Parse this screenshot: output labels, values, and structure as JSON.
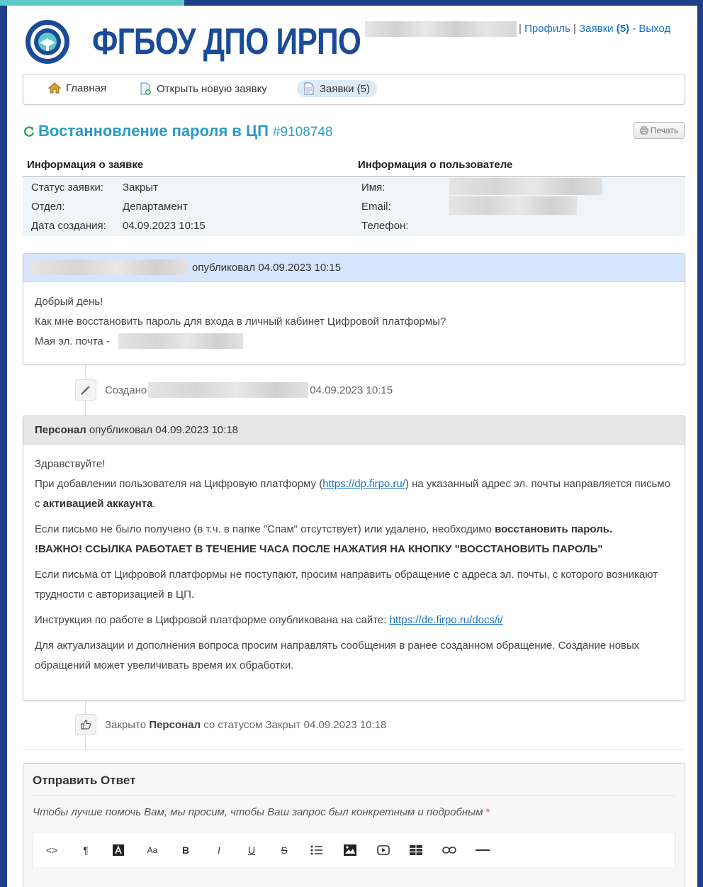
{
  "header": {
    "logo_text": "ФГБОУ ДПО ИРПО",
    "links": {
      "profile": "Профиль",
      "sep1": "|",
      "tickets": "Заявки",
      "tickets_count": "(5)",
      "dash": "-",
      "logout": "Выход"
    }
  },
  "nav": {
    "home": "Главная",
    "new_ticket": "Открыть новую заявку",
    "tickets": "Заявки (5)"
  },
  "ticket": {
    "title": "Востанновление пароля в ЦП",
    "number": "#9108748",
    "print_label": "Печать"
  },
  "info": {
    "ticket_heading": "Информация о заявке",
    "user_heading": "Информация о пользователе",
    "status_label": "Статус заявки:",
    "status_value": "Закрыт",
    "dept_label": "Отдел:",
    "dept_value": "Департамент",
    "date_label": "Дата создания:",
    "date_value": "04.09.2023 10:15",
    "name_label": "Имя:",
    "email_label": "Email:",
    "phone_label": "Телефон:"
  },
  "message1": {
    "posted": "опубликовал 04.09.2023 10:15",
    "line1": "Добрый день!",
    "line2": "Как мне восстановить пароль для входа в личный кабинет Цифровой платформы?",
    "line3": "Мая эл. почта -"
  },
  "event1": {
    "label": "Создано",
    "time": "04.09.2023 10:15"
  },
  "message2": {
    "author": "Персонал",
    "posted": "опубликовал 04.09.2023 10:18",
    "greeting": "Здравствуйте!",
    "p1_a": "При добавлении пользователя на Цифровую платформу (",
    "p1_link": "https://dp.firpo.ru/",
    "p1_b": ") на указанный адрес эл. почты направляется письмо с ",
    "p1_bold": "активацией аккаунта",
    "p1_c": ".",
    "p2_a": "Если письмо не было получено (в т.ч. в папке \"Спам\" отсутствует) или удалено, необходимо ",
    "p2_bold": "восстановить пароль.",
    "p2_warn": "!ВАЖНО! ССЫЛКА РАБОТАЕТ В ТЕЧЕНИЕ ЧАСА ПОСЛЕ НАЖАТИЯ НА КНОПКУ \"ВОССТАНОВИТЬ ПАРОЛЬ\"",
    "p3": "Если письма от Цифровой платформы не поступают, просим направить обращение с адреса эл. почты, с которого возникают трудности с авторизацией в ЦП.",
    "p4_a": "Инструкция по работе в Цифровой платформе опубликована на сайте: ",
    "p4_link": "https://de.firpo.ru/docs/i/",
    "p5": "Для актуализации и дополнения вопроса просим направлять сообщения в ранее созданном обращение. Создание новых обращений может увеличивать время их обработки."
  },
  "event2": {
    "a": "Закрыто",
    "author": "Персонал",
    "b": "со статусом Закрыт 04.09.2023 10:18"
  },
  "reply": {
    "title": "Отправить Ответ",
    "hint": "Чтобы лучше помочь Вам, мы просим, чтобы Ваш запрос был конкретным и подробным",
    "required": "*",
    "toolbar": {
      "code": "<>",
      "paragraph": "¶",
      "font_size": "Aa",
      "bold": "B",
      "italic": "I",
      "underline": "U",
      "strike": "S"
    }
  }
}
